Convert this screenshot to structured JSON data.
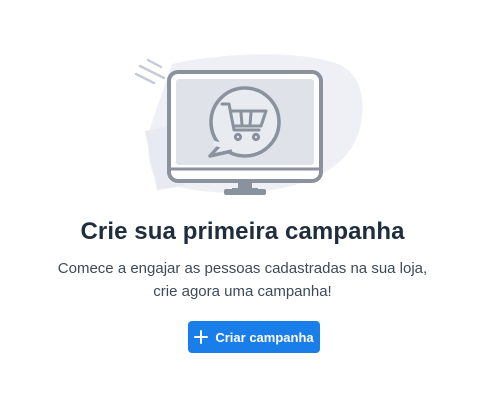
{
  "empty_state": {
    "title": "Crie sua primeira campanha",
    "description_line1": "Comece a engajar as pessoas cadastradas na sua loja,",
    "description_line2": "crie agora uma campanha!",
    "illustration_icon": "monitor-with-shopping-cart-chat-bubble"
  },
  "actions": {
    "create_campaign_label": "Criar campanha",
    "create_campaign_icon": "plus-icon"
  },
  "colors": {
    "primary_button": "#1a7eea",
    "title_text": "#1f2d3d",
    "body_text": "#3d4a5a",
    "illustration_stroke": "#8a929e",
    "illustration_fill": "#dfe2e8"
  }
}
